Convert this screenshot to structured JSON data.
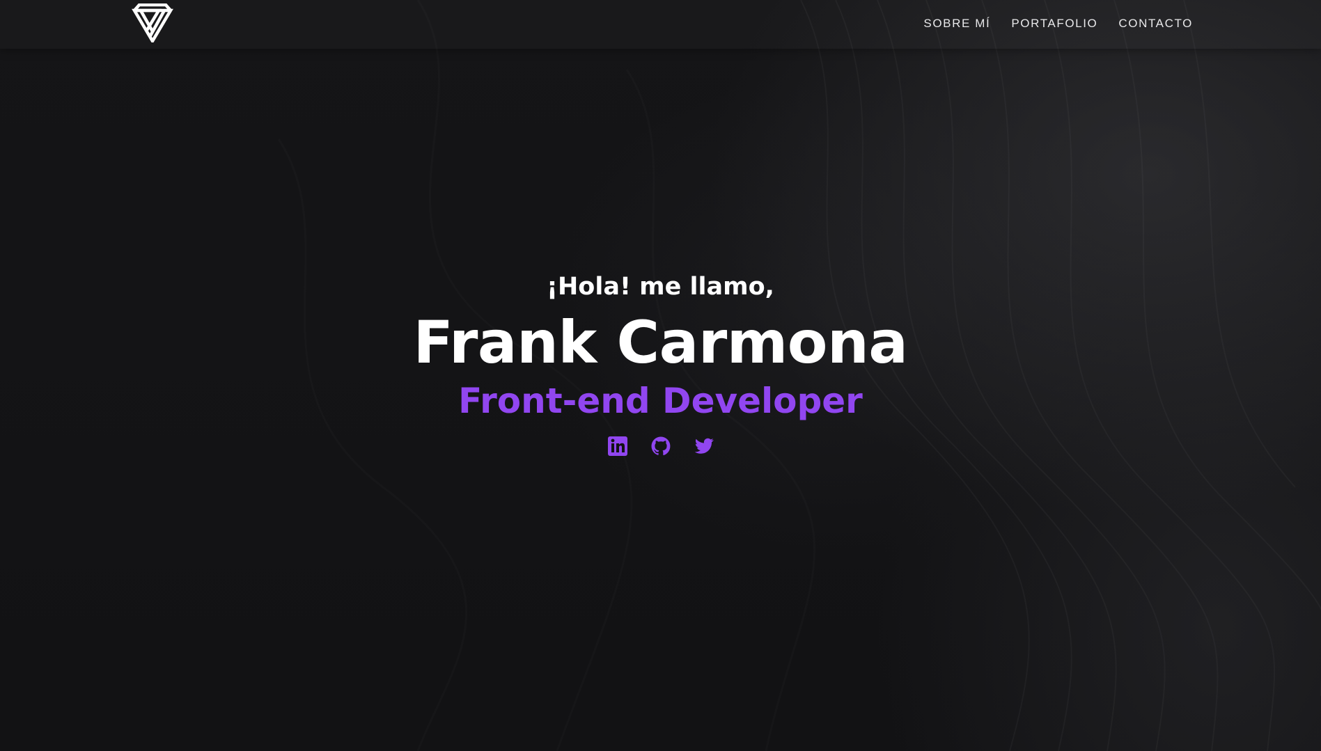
{
  "nav": {
    "logo_icon": "triangle-logo-icon",
    "links": [
      {
        "label": "SOBRE MÍ"
      },
      {
        "label": "PORTAFOLIO"
      },
      {
        "label": "CONTACTO"
      }
    ]
  },
  "hero": {
    "greeting": "¡Hola! me llamo,",
    "name": "Frank Carmona",
    "role": "Front-end Developer"
  },
  "socials": [
    {
      "icon": "linkedin-icon"
    },
    {
      "icon": "github-icon"
    },
    {
      "icon": "twitter-icon"
    }
  ],
  "colors": {
    "background": "#121214",
    "accent": "#9146f0",
    "text": "#ffffff"
  }
}
